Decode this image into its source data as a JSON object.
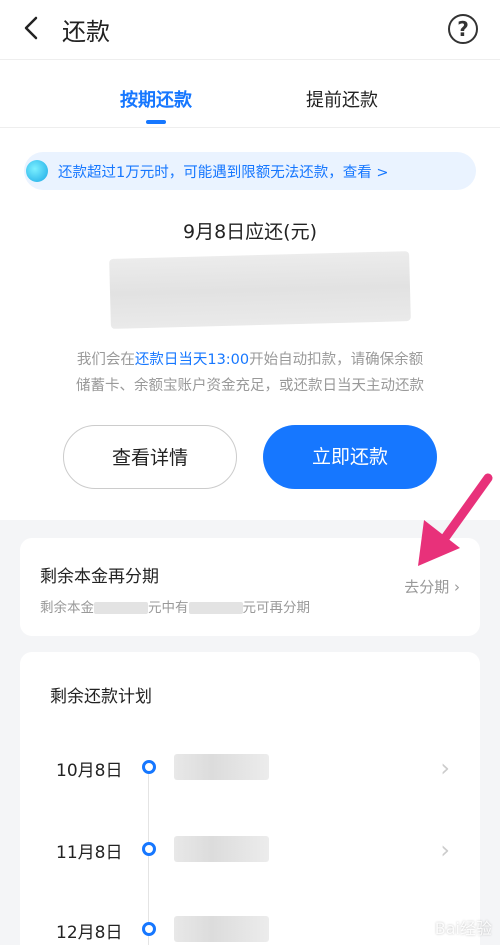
{
  "header": {
    "title": "还款",
    "help_icon": "?"
  },
  "tabs": [
    {
      "label": "按期还款",
      "active": true
    },
    {
      "label": "提前还款",
      "active": false
    }
  ],
  "notice": {
    "text": "还款超过1万元时，可能遇到限额无法还款，查看 >"
  },
  "due": {
    "title": "9月8日应还(元)"
  },
  "auto_deduct": {
    "prefix": "我们会在",
    "highlight": "还款日当天13:00",
    "suffix": "开始自动扣款，请确保余额",
    "line2": "储蓄卡、余额宝账户资金充足，或还款日当天主动还款"
  },
  "buttons": {
    "detail": "查看详情",
    "pay": "立即还款"
  },
  "installment": {
    "title": "剩余本金再分期",
    "sub_a": "剩余本金",
    "sub_b": "元中有",
    "sub_c": "元可再分期",
    "link": "去分期",
    "chevron": "›"
  },
  "plan": {
    "title": "剩余还款计划",
    "rows": [
      {
        "date": "10月8日"
      },
      {
        "date": "11月8日"
      },
      {
        "date": "12月8日"
      }
    ]
  },
  "watermark": "Bai经验",
  "colors": {
    "accent": "#1677ff",
    "arrow": "#e8317a"
  }
}
